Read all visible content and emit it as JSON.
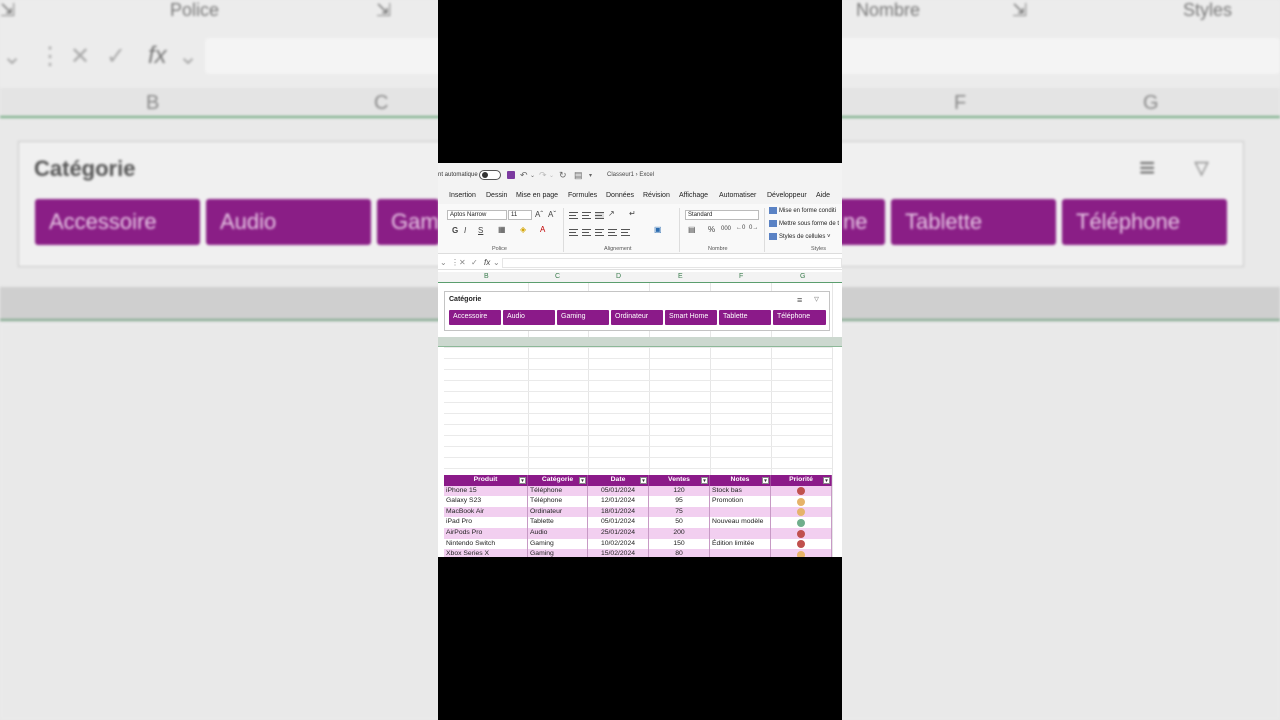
{
  "backdrop": {
    "ribbon": [
      "Police",
      "Nombre",
      "Styles"
    ],
    "fx_label": "fx",
    "columns": [
      "B",
      "C",
      "F",
      "G"
    ],
    "slicer_title": "Catégorie",
    "slicer_items": [
      "Accessoire",
      "Audio",
      "Gam",
      "ne",
      "Tablette",
      "Téléphone"
    ]
  },
  "titlebar": {
    "autosave": "nt automatique",
    "document": "Classeur1 › Excel"
  },
  "menu": [
    "Insertion",
    "Dessin",
    "Mise en page",
    "Formules",
    "Données",
    "Révision",
    "Affichage",
    "Automatiser",
    "Développeur",
    "Aide"
  ],
  "ribbon": {
    "font_name": "Aptos Narrow",
    "font_size": "11",
    "number_format": "Standard",
    "bold": "G",
    "italic": "I",
    "underline": "S",
    "percent": "%",
    "thousands": "000",
    "styles": [
      "Mise en forme conditi",
      "Mettre sous forme de t",
      "Styles de cellules ˅"
    ],
    "groups": [
      "Police",
      "Alignement",
      "Nombre",
      "Styles"
    ]
  },
  "formula_bar": {
    "fx": "fx"
  },
  "columns": [
    "B",
    "C",
    "D",
    "E",
    "F",
    "G"
  ],
  "slicer": {
    "title": "Catégorie",
    "items": [
      "Accessoire",
      "Audio",
      "Gaming",
      "Ordinateur",
      "Smart Home",
      "Tablette",
      "Téléphone"
    ]
  },
  "table": {
    "headers": [
      "Produit",
      "Catégorie",
      "Date",
      "Ventes",
      "Notes",
      "Priorité"
    ],
    "rows": [
      [
        "iPhone 15",
        "Téléphone",
        "05/01/2024",
        "120",
        "Stock bas",
        "red"
      ],
      [
        "Galaxy S23",
        "Téléphone",
        "12/01/2024",
        "95",
        "Promotion",
        "orange"
      ],
      [
        "MacBook Air",
        "Ordinateur",
        "18/01/2024",
        "75",
        "",
        "orange"
      ],
      [
        "iPad Pro",
        "Tablette",
        "05/01/2024",
        "50",
        "Nouveau modèle",
        "green"
      ],
      [
        "AirPods Pro",
        "Audio",
        "25/01/2024",
        "200",
        "",
        "red"
      ],
      [
        "Nintendo Switch",
        "Gaming",
        "10/02/2024",
        "150",
        "Édition limitée",
        "red"
      ],
      [
        "Xbox Series X",
        "Gaming",
        "15/02/2024",
        "80",
        "",
        "orange"
      ]
    ]
  },
  "colors": {
    "accent": "#8b1a89",
    "band": "#f2cff0",
    "red": "#c0504d",
    "orange": "#e6b36a",
    "green": "#6fae8c"
  }
}
